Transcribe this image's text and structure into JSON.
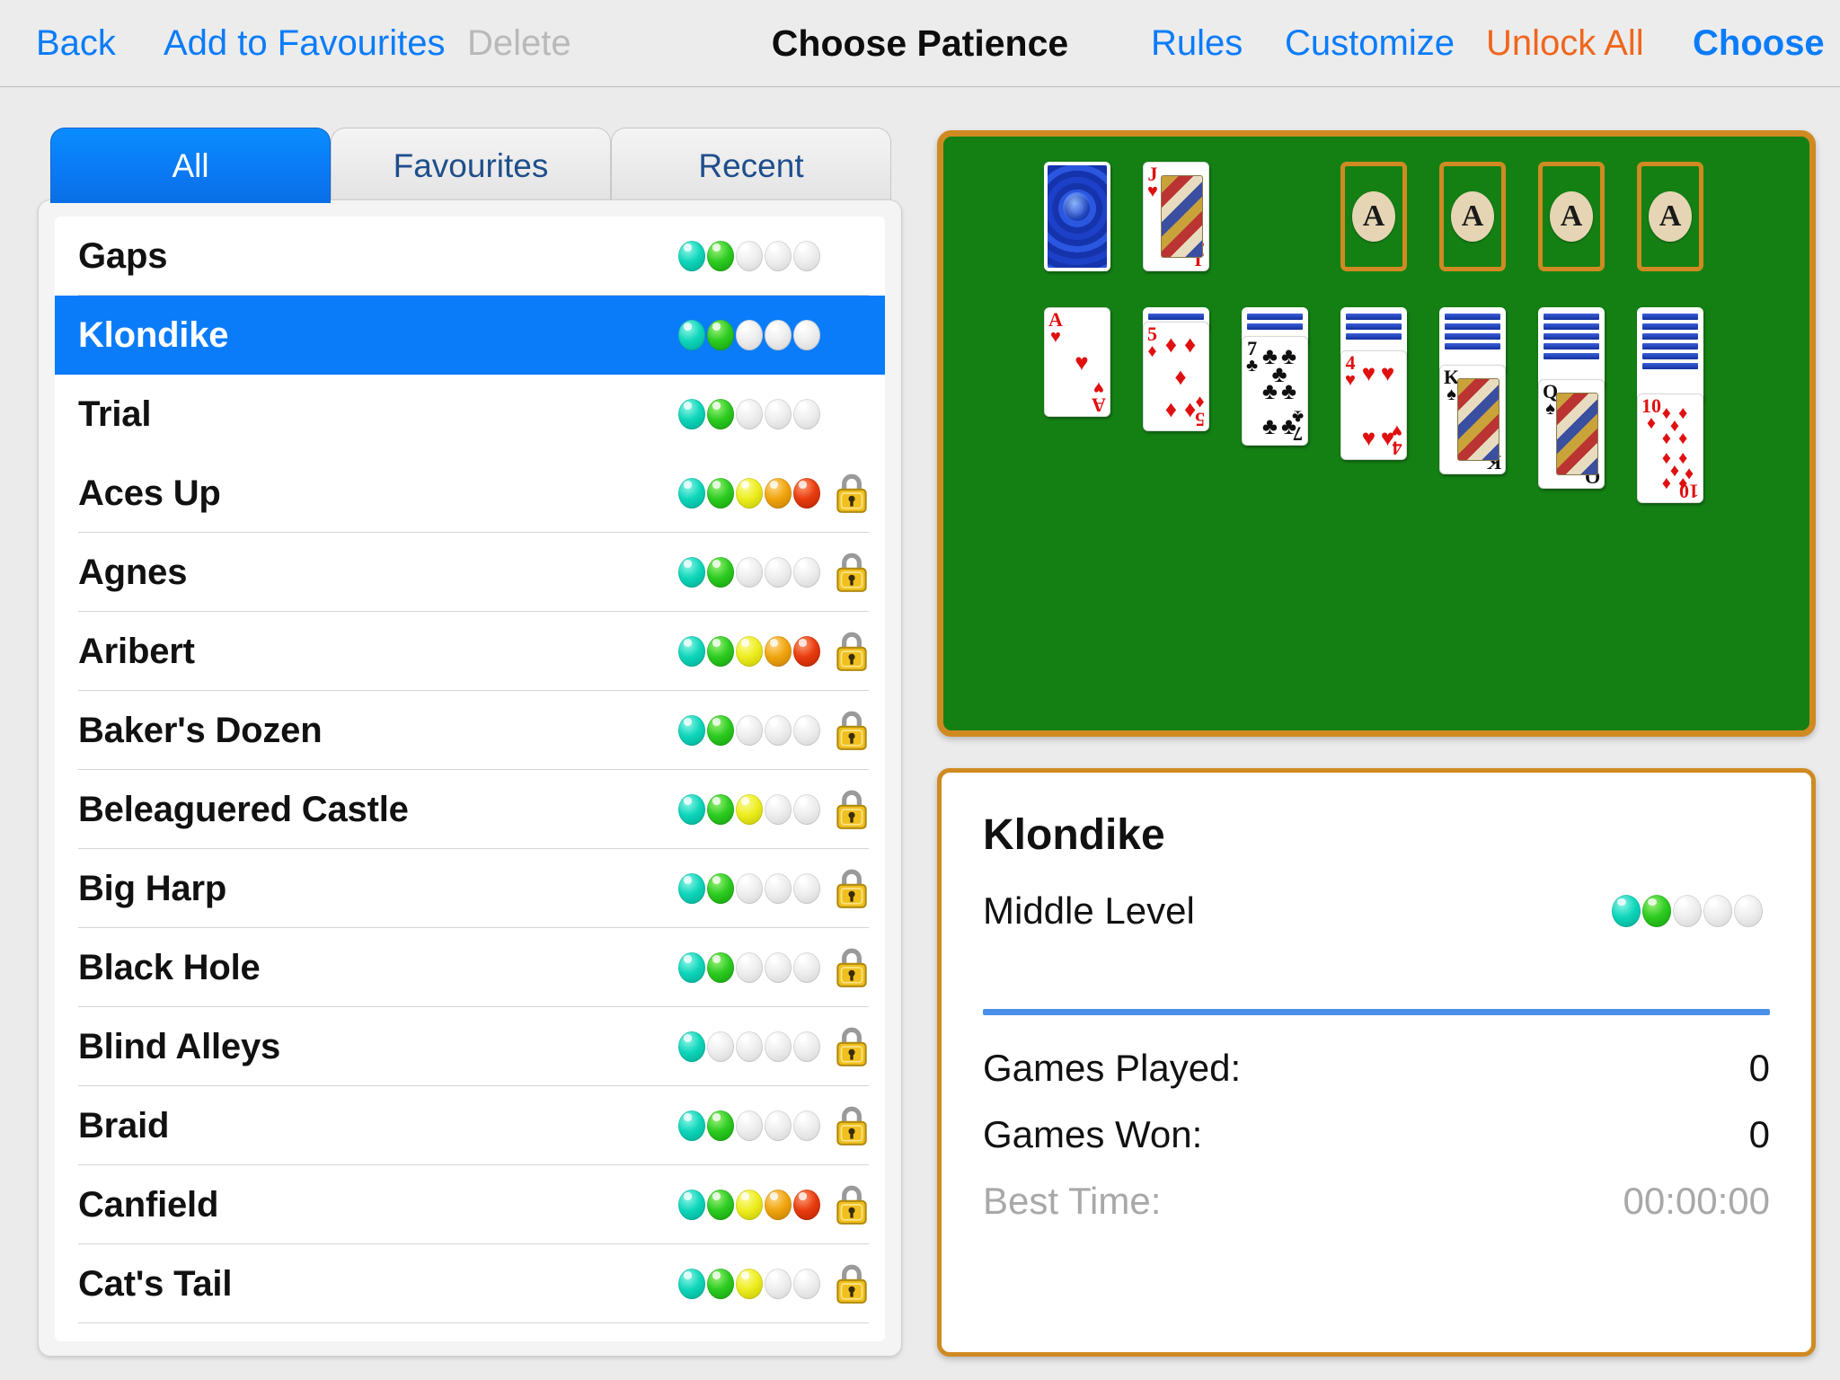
{
  "toolbar": {
    "back": "Back",
    "add_to_favourites": "Add to Favourites",
    "delete": "Delete",
    "title": "Choose Patience",
    "rules": "Rules",
    "customize": "Customize",
    "unlock_all": "Unlock All",
    "choose": "Choose"
  },
  "tabs": [
    {
      "label": "All",
      "selected": true
    },
    {
      "label": "Favourites",
      "selected": false
    },
    {
      "label": "Recent",
      "selected": false
    }
  ],
  "game_list": [
    {
      "name": "Gaps",
      "difficulty": 2,
      "locked": false,
      "selected": false
    },
    {
      "name": "Klondike",
      "difficulty": 2,
      "locked": false,
      "selected": true
    },
    {
      "name": "Trial",
      "difficulty": 2,
      "locked": false,
      "selected": false
    },
    {
      "name": "Aces Up",
      "difficulty": 5,
      "locked": true,
      "selected": false
    },
    {
      "name": "Agnes",
      "difficulty": 2,
      "locked": true,
      "selected": false
    },
    {
      "name": "Aribert",
      "difficulty": 5,
      "locked": true,
      "selected": false
    },
    {
      "name": "Baker's Dozen",
      "difficulty": 2,
      "locked": true,
      "selected": false
    },
    {
      "name": "Beleaguered Castle",
      "difficulty": 3,
      "locked": true,
      "selected": false
    },
    {
      "name": "Big Harp",
      "difficulty": 2,
      "locked": true,
      "selected": false
    },
    {
      "name": "Black Hole",
      "difficulty": 2,
      "locked": true,
      "selected": false
    },
    {
      "name": "Blind Alleys",
      "difficulty": 1,
      "locked": true,
      "selected": false
    },
    {
      "name": "Braid",
      "difficulty": 2,
      "locked": true,
      "selected": false
    },
    {
      "name": "Canfield",
      "difficulty": 5,
      "locked": true,
      "selected": false
    },
    {
      "name": "Cat's Tail",
      "difficulty": 3,
      "locked": true,
      "selected": false
    }
  ],
  "difficulty_colors": [
    "#0fd6bb",
    "#2dcc22",
    "#eded20",
    "#f0a50e",
    "#e83c10",
    "#e0e0e0"
  ],
  "preview": {
    "table_color": "#148014",
    "frame_color": "#d08a22",
    "stock": {
      "facedown": true,
      "back_style": "blue-swirl"
    },
    "waste": [
      {
        "rank": "J",
        "suit": "hearts",
        "color": "red"
      }
    ],
    "foundations": [
      {
        "placeholder": "A"
      },
      {
        "placeholder": "A"
      },
      {
        "placeholder": "A"
      },
      {
        "placeholder": "A"
      }
    ],
    "tableau": [
      {
        "facedown": 0,
        "top": {
          "rank": "A",
          "suit": "hearts",
          "color": "red"
        }
      },
      {
        "facedown": 1,
        "top": {
          "rank": "5",
          "suit": "diamonds",
          "color": "red"
        }
      },
      {
        "facedown": 2,
        "top": {
          "rank": "7",
          "suit": "clubs",
          "color": "black"
        }
      },
      {
        "facedown": 3,
        "top": {
          "rank": "4",
          "suit": "hearts",
          "color": "red"
        }
      },
      {
        "facedown": 4,
        "top": {
          "rank": "K",
          "suit": "spades",
          "color": "black"
        }
      },
      {
        "facedown": 5,
        "top": {
          "rank": "Q",
          "suit": "spades",
          "color": "black"
        }
      },
      {
        "facedown": 6,
        "top": {
          "rank": "10",
          "suit": "diamonds",
          "color": "red"
        }
      }
    ]
  },
  "info": {
    "title": "Klondike",
    "level_label": "Middle Level",
    "level_difficulty": 2,
    "divider_color": "#4a90e8",
    "stats": [
      {
        "label": "Games Played:",
        "value": "0",
        "muted": false
      },
      {
        "label": "Games Won:",
        "value": "0",
        "muted": false
      },
      {
        "label": "Best Time:",
        "value": "00:00:00",
        "muted": true
      }
    ]
  }
}
